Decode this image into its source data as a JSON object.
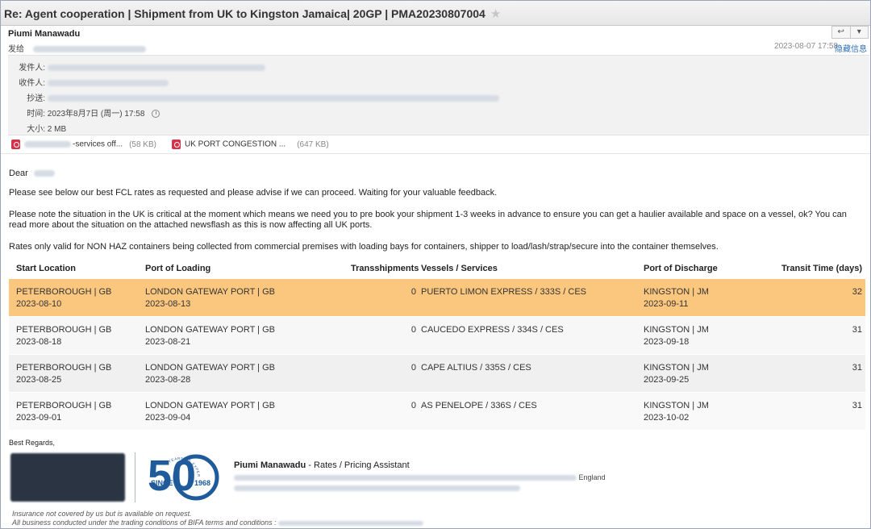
{
  "email": {
    "subject": "Re: Agent cooperation | Shipment from UK to Kingston Jamaica| 20GP | PMA20230807004",
    "star_icon": "star-icon",
    "sender_name": "Piumi Manawadu",
    "send_to_label": "发给",
    "date": "2023-08-07 17:58",
    "hide_info_label": "隐藏信息",
    "reply_icons": [
      "reply-icon",
      "dropdown-icon"
    ]
  },
  "details": {
    "from_label": "发件人:",
    "to_label": "收件人:",
    "cc_label": "抄送:",
    "time_label": "时间:",
    "time_value": "2023年8月7日 (周一) 17:58",
    "size_label": "大小:",
    "size_value": "2 MB"
  },
  "attachments": [
    {
      "name": "-services off...",
      "size": "(58 KB)",
      "icon": "pdf-icon"
    },
    {
      "name": "UK PORT CONGESTION ...",
      "size": "(647 KB)",
      "icon": "pdf-icon"
    }
  ],
  "body": {
    "greeting": "Dear",
    "p1": "Please see below our best FCL rates as requested and please advise if we can proceed. Waiting for your valuable feedback.",
    "p2a": "Please note the situation in the UK is critical at the moment which means we need you to pre book your shipment 1-3 weeks in advance to ensure you can get a haulier available and space on a vessel, ok? You can",
    "p2b": "read more about the situation on the attached newsflash as this is now affecting all UK ports.",
    "p3": "Rates only valid for NON HAZ containers being collected from commercial premises with loading bays for containers, shipper to load/lash/strap/secure into the container themselves."
  },
  "table": {
    "headers": {
      "start": "Start Location",
      "pol": "Port of Loading",
      "trans": "Transshipments",
      "vessel": "Vessels / Services",
      "pod": "Port of Discharge",
      "transit": "Transit Time (days)"
    },
    "rows": [
      {
        "start": "PETERBOROUGH | GB",
        "start_date": "2023-08-10",
        "pol": "LONDON GATEWAY PORT | GB",
        "pol_date": "2023-08-13",
        "trans": "0",
        "vessel": "PUERTO LIMON EXPRESS / 333S / CES",
        "pod": "KINGSTON | JM",
        "pod_date": "2023-09-11",
        "transit": "32"
      },
      {
        "start": "PETERBOROUGH | GB",
        "start_date": "2023-08-18",
        "pol": "LONDON GATEWAY PORT | GB",
        "pol_date": "2023-08-21",
        "trans": "0",
        "vessel": "CAUCEDO EXPRESS / 334S / CES",
        "pod": "KINGSTON | JM",
        "pod_date": "2023-09-18",
        "transit": "31"
      },
      {
        "start": "PETERBOROUGH | GB",
        "start_date": "2023-08-25",
        "pol": "LONDON GATEWAY PORT | GB",
        "pol_date": "2023-08-28",
        "trans": "0",
        "vessel": "CAPE ALTIUS / 335S / CES",
        "pod": "KINGSTON | JM",
        "pod_date": "2023-09-25",
        "transit": "31"
      },
      {
        "start": "PETERBOROUGH | GB",
        "start_date": "2023-09-01",
        "pol": "LONDON GATEWAY PORT | GB",
        "pol_date": "2023-09-04",
        "trans": "0",
        "vessel": "AS PENELOPE / 336S / CES",
        "pod": "KINGSTON | JM",
        "pod_date": "2023-10-02",
        "transit": "31"
      }
    ]
  },
  "signature": {
    "regards": "Best Regards,",
    "name": "Piumi Manawadu",
    "role": " - Rates / Pricing Assistant",
    "country": "England",
    "badge_number": "50",
    "badge_ring_text": "YEARS OF EXPERIENCE",
    "badge_since": "SINCE",
    "badge_year": "1968",
    "badge_color": "#1f5a9a",
    "footer1": "Insurance not covered by us but is available on request.",
    "footer2": "All business conducted under the trading conditions of BIFA terms and conditions :"
  },
  "colors": {
    "highlight_row": "#fbc77f",
    "link": "#2f6fb3",
    "pdf": "#d9304a"
  }
}
